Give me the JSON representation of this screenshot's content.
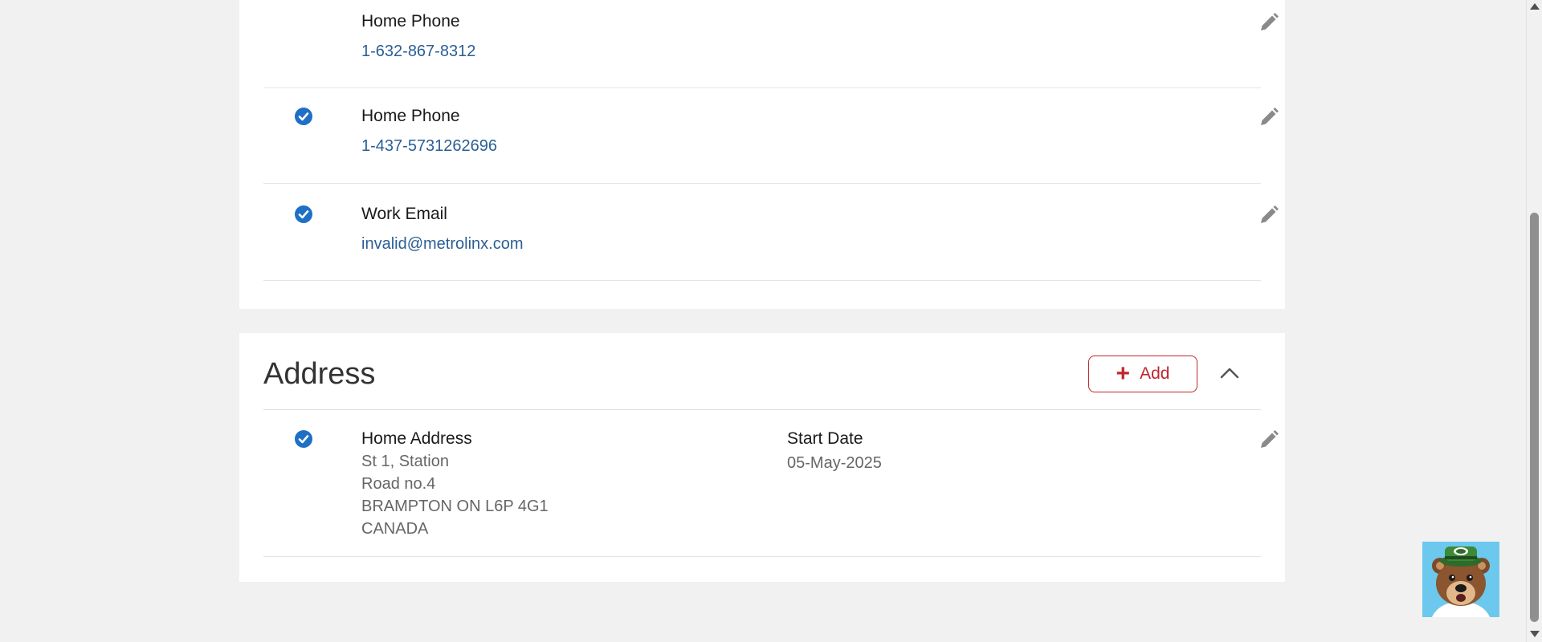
{
  "contacts": [
    {
      "label": "Home Phone",
      "value": "1-632-867-8312",
      "primary": false
    },
    {
      "label": "Home Phone",
      "value": "1-437-5731262696",
      "primary": true
    },
    {
      "label": "Work Email",
      "value": "invalid@metrolinx.com",
      "primary": true
    }
  ],
  "address_section": {
    "title": "Address",
    "add_label": "Add",
    "entry": {
      "label": "Home Address",
      "primary": true,
      "lines": [
        "St 1, Station",
        "Road no.4",
        "BRAMPTON ON L6P 4G1",
        "CANADA"
      ],
      "start_date_label": "Start Date",
      "start_date_value": "05-May-2025"
    }
  },
  "icons": {
    "edit": "pencil-icon",
    "primary": "check-circle-icon",
    "add": "plus-icon",
    "collapse": "chevron-up-icon",
    "assistant": "bear-mascot-icon"
  },
  "colors": {
    "link": "#2b5e94",
    "accent_red": "#c0272d",
    "check_blue": "#1f6fc5",
    "mascot_bg": "#6cc8ec"
  }
}
